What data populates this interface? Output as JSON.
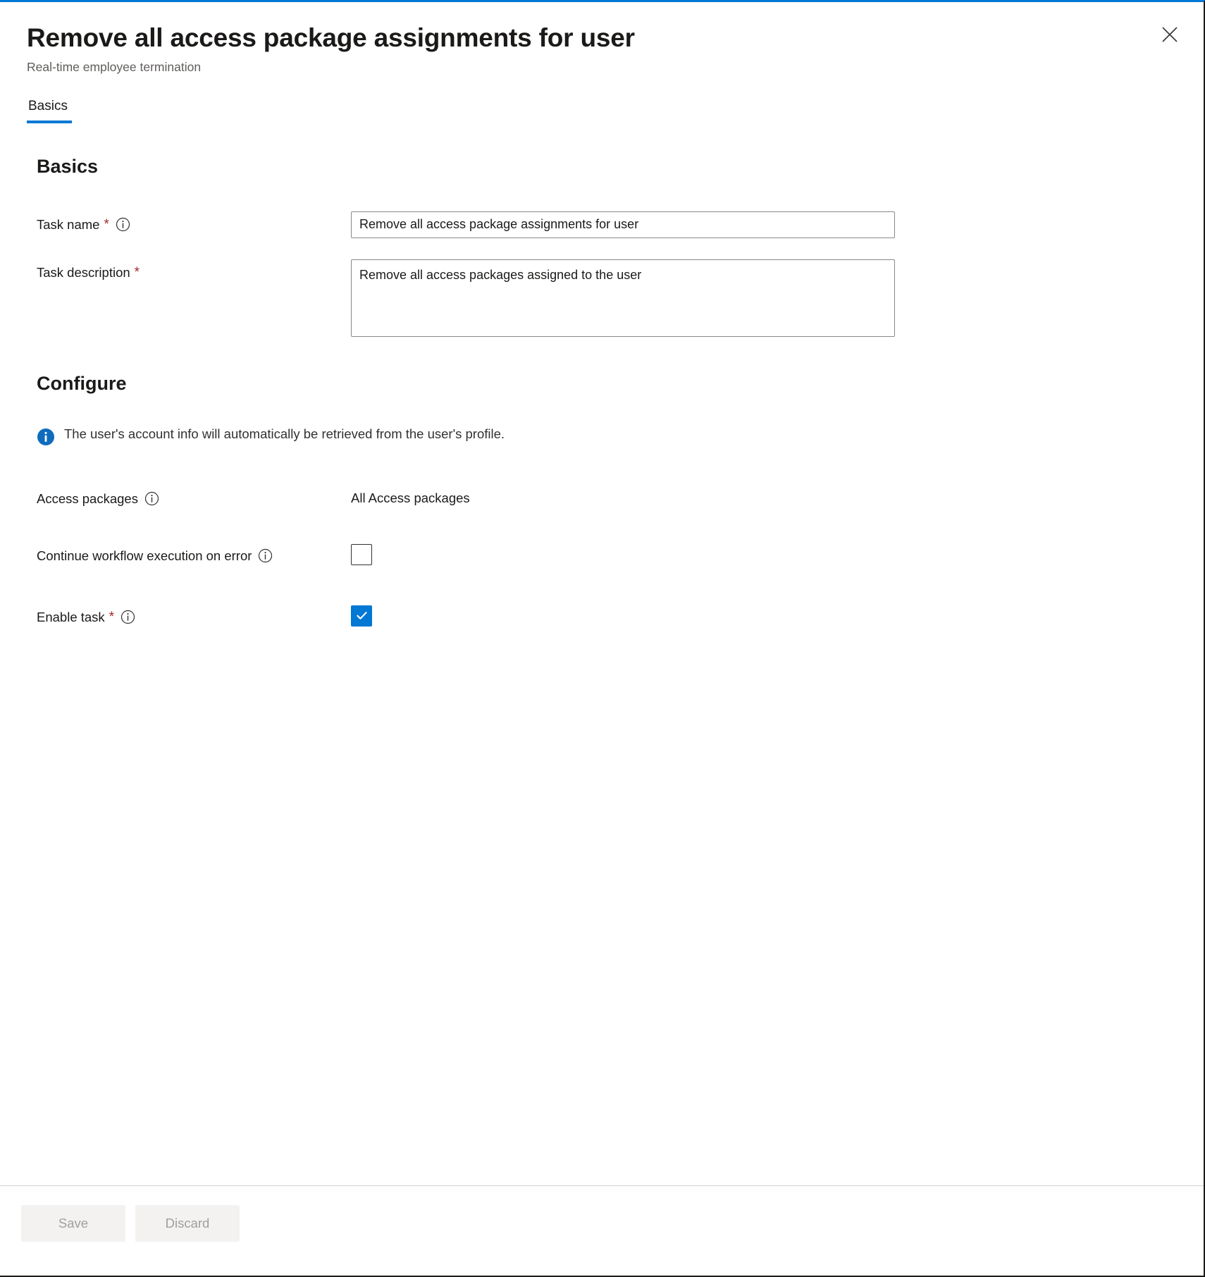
{
  "blade": {
    "title": "Remove all access package assignments for user",
    "subtitle": "Real-time employee termination",
    "close_label": "Close"
  },
  "tabs": [
    {
      "label": "Basics",
      "selected": true
    }
  ],
  "sections": {
    "basics": {
      "heading": "Basics",
      "task_name": {
        "label": "Task name",
        "required_marker": "*",
        "value": "Remove all access package assignments for user",
        "placeholder": "Task name"
      },
      "task_description": {
        "label": "Task description",
        "required_marker": "*",
        "value": "Remove all access packages assigned to the user",
        "placeholder": "Task description"
      }
    },
    "configure": {
      "heading": "Configure",
      "info_message": "The user's account info will automatically be retrieved from the user's profile.",
      "access_packages": {
        "label": "Access packages",
        "value": "All Access packages"
      },
      "continue_on_error": {
        "label": "Continue workflow execution on error",
        "checked": false
      },
      "enable_task": {
        "label": "Enable task",
        "required_marker": "*",
        "checked": true
      }
    }
  },
  "footer": {
    "save_label": "Save",
    "discard_label": "Discard"
  },
  "colors": {
    "accent": "#0078d4",
    "required": "#a4262c",
    "text": "#1b1a19",
    "muted": "#605e5c",
    "disabled_text": "#a19f9d",
    "disabled_bg": "#f3f2f1",
    "border": "#8a8886"
  }
}
